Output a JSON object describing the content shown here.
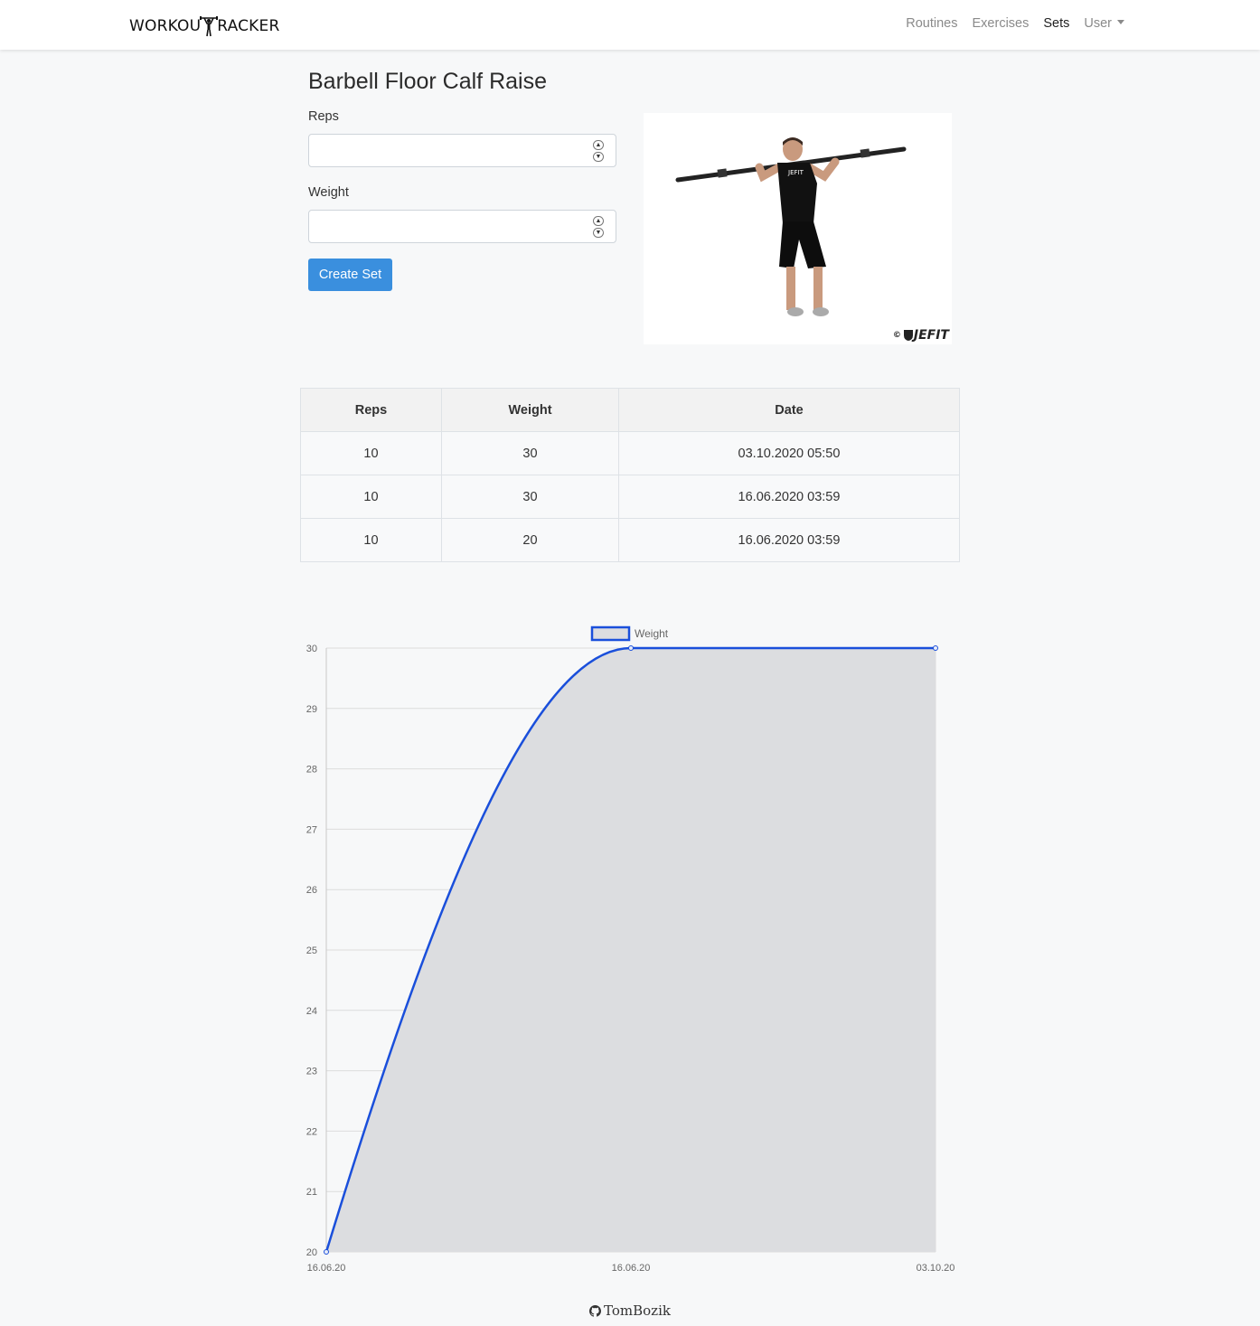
{
  "brand": {
    "text_left": "WORKOU",
    "text_right": "RACKER"
  },
  "nav": {
    "routines": "Routines",
    "exercises": "Exercises",
    "sets": "Sets",
    "user": "User"
  },
  "exercise": {
    "title": "Barbell Floor Calf Raise",
    "image_credit": "JEFIT",
    "copyright_symbol": "©"
  },
  "form": {
    "reps_label": "Reps",
    "reps_value": "",
    "weight_label": "Weight",
    "weight_value": "",
    "submit_label": "Create Set"
  },
  "table": {
    "headers": [
      "Reps",
      "Weight",
      "Date"
    ],
    "rows": [
      [
        "10",
        "30",
        "03.10.2020 05:50"
      ],
      [
        "10",
        "30",
        "16.06.2020 03:59"
      ],
      [
        "10",
        "20",
        "16.06.2020 03:59"
      ]
    ]
  },
  "chart_data": {
    "type": "line",
    "title": "",
    "xlabel": "",
    "ylabel": "",
    "categories": [
      "16.06.20",
      "16.06.20",
      "03.10.20"
    ],
    "series": [
      {
        "name": "Weight",
        "values": [
          20,
          30,
          30
        ]
      }
    ],
    "ylim": [
      20,
      30
    ],
    "yticks": [
      20,
      21,
      22,
      23,
      24,
      25,
      26,
      27,
      28,
      29,
      30
    ],
    "fill": true,
    "grid": true,
    "legend": "top-center",
    "colors": {
      "line": "#1a4fdb",
      "fill": "#dcdde0"
    }
  },
  "footer": {
    "text": "TomBozik"
  }
}
